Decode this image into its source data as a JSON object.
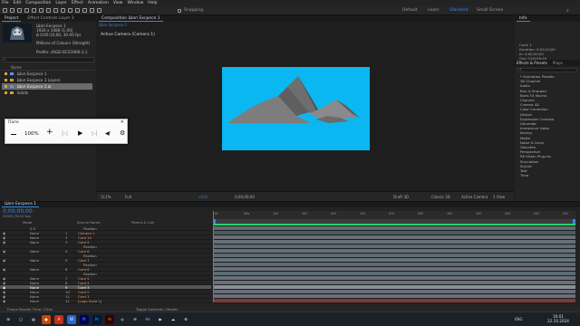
{
  "menu": [
    "File",
    "Edit",
    "Composition",
    "Layer",
    "Effect",
    "Animation",
    "View",
    "Window",
    "Help"
  ],
  "toolbar": {
    "snapping_label": "Snapping",
    "workspaces": [
      "Default",
      "Learn",
      "Standard",
      "Small Screen"
    ],
    "active_workspace": "Standard"
  },
  "project": {
    "tabs": [
      "Project",
      "Effect Controls Layer 3"
    ],
    "comp_name": "Шоп Ексресе 1",
    "comp_info": [
      "1920 x 1080 (1.00)",
      "Δ 0;00;10;00, 30.00 fps"
    ],
    "comp_info2": "Millions of Colours (Straight)",
    "comp_info3": "Profile: sRGB IEC61966-2.1",
    "search_placeholder": "",
    "list_header": "Name",
    "items": [
      {
        "name": "Шоп Ексресе 1",
        "color": "#e0a030"
      },
      {
        "name": "Шоп Ексресе 1 Layers",
        "color": "#e0a030"
      },
      {
        "name": "Шоп Ексресе 1.ai",
        "color": "#e0a030"
      },
      {
        "name": "Solids",
        "color": "#e0a030"
      }
    ]
  },
  "composition": {
    "tab": "Composition Шоп Ексресе 1",
    "sub_tab": "Шоп Ексресе 1",
    "camera_label": "Active Camera (Camera 1)",
    "frame_color": "#0ab7f0",
    "footer": {
      "zoom": "111%",
      "quality": "Full",
      "timecode": "0;00;00;00",
      "renderer": "Draft 3D",
      "renderer2": "Classic 3D",
      "camera": "Active Camera",
      "views": "1 View",
      "offset": "+0.0"
    }
  },
  "info_panel": {
    "tab": "Info",
    "lines": [
      "Cord: 1",
      "Duration: 0;00;10;00",
      "In: 0;00;00;00",
      "Out: 0;00;09;29"
    ]
  },
  "effects_panel": {
    "tabs": [
      "Effects & Presets",
      "Props"
    ],
    "search_placeholder": "",
    "items": [
      "* Animation Presets",
      "3D Channel",
      "Audio",
      "Blur & Sharpen",
      "Boris FX Mocha",
      "Channel",
      "Cinema 4D",
      "Color Correction",
      "Distort",
      "Expression Controls",
      "Generate",
      "Immersive Video",
      "Keying",
      "Matte",
      "Noise & Grain",
      "Obsolete",
      "Perspective",
      "RE:Vision Plug-ins",
      "Simulation",
      "Stylize",
      "Text",
      "Time"
    ]
  },
  "player": {
    "title": "Папе",
    "zoom": "100%"
  },
  "timeline": {
    "tab": "Шоп Ексресе 1",
    "timecode": "0;00;00;00",
    "timecode_sub": "00000 (30.00 fps)",
    "columns": [
      "Source Name",
      "Parent & Link",
      "Mode"
    ],
    "ruler": [
      "0f",
      "05s",
      "10f",
      "15f",
      "20f",
      "25f",
      "01f",
      "05f",
      "10f",
      "15f",
      "20f",
      "25f",
      "02f"
    ],
    "layers": [
      {
        "num": "",
        "name": "Position",
        "parent": "0.0",
        "highlight": false,
        "bar": "#5b6c72"
      },
      {
        "num": "1",
        "name": "Camera 1",
        "parent": "None",
        "highlight": false,
        "bar": "#4d5a5f"
      },
      {
        "num": "2",
        "name": "Cord 10",
        "parent": "None",
        "highlight": false,
        "bar": "#6a6f78"
      },
      {
        "num": "3",
        "name": "Cord 9",
        "parent": "None",
        "highlight": false,
        "bar": "#6a6f78"
      },
      {
        "num": "",
        "name": "Position",
        "parent": "",
        "highlight": false,
        "bar": "#5b6c72"
      },
      {
        "num": "4",
        "name": "Cord 8",
        "parent": "None",
        "highlight": false,
        "bar": "#6a6f78"
      },
      {
        "num": "",
        "name": "Position",
        "parent": "",
        "highlight": false,
        "bar": "#5b6c72"
      },
      {
        "num": "5",
        "name": "Cord 7",
        "parent": "None",
        "highlight": false,
        "bar": "#6a6f78"
      },
      {
        "num": "",
        "name": "Position",
        "parent": "",
        "highlight": false,
        "bar": "#5b6c72"
      },
      {
        "num": "6",
        "name": "Cord 6",
        "parent": "None",
        "highlight": false,
        "bar": "#6a6f78"
      },
      {
        "num": "",
        "name": "Position",
        "parent": "",
        "highlight": false,
        "bar": "#5b6c72"
      },
      {
        "num": "7",
        "name": "Cord 5",
        "parent": "None",
        "highlight": false,
        "bar": "#6a6f78"
      },
      {
        "num": "8",
        "name": "Cord 4",
        "parent": "None",
        "highlight": false,
        "bar": "#6a6f78"
      },
      {
        "num": "9",
        "name": "Cord 3",
        "parent": "None",
        "highlight": true,
        "bar": "#8a8f98"
      },
      {
        "num": "10",
        "name": "Cord 2",
        "parent": "None",
        "highlight": false,
        "bar": "#6a6f78"
      },
      {
        "num": "11",
        "name": "Cord 1",
        "parent": "None",
        "highlight": false,
        "bar": "#6a6f78"
      },
      {
        "num": "12",
        "name": "[Logo Solid 1]",
        "parent": "None",
        "highlight": false,
        "bar": "#7a3a3a"
      }
    ],
    "footer_left": "Frame Render Time: 13ms",
    "footer_mid": "Toggle Switches / Modes"
  },
  "taskbar": {
    "time": "16:01",
    "date": "22.10.2024",
    "lang": "ENG"
  }
}
